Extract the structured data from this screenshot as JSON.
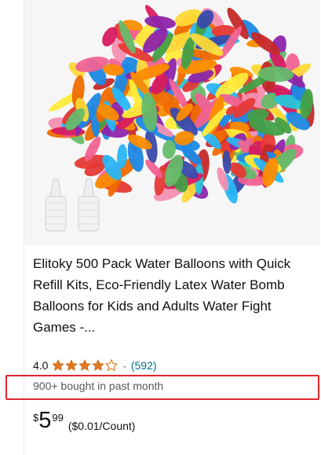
{
  "product": {
    "title": "Elitoky 500 Pack Water Balloons with Quick Refill Kits, Eco-Friendly Latex Water Bomb Balloons for Kids and Adults Water Fight Games -...",
    "rating": {
      "value": "4.0",
      "stars": 4,
      "max_stars": 5,
      "dropdown_icon": "chevron-down-icon",
      "review_count": "(592)"
    },
    "bought_text": "900+ bought in past month",
    "price": {
      "symbol": "$",
      "whole": "5",
      "fraction": "99",
      "unit_price": "($0.01/Count)"
    },
    "image_icon": "water-balloons-image"
  },
  "colors": {
    "title_text": "#0f1111",
    "star": "#de7921",
    "link": "#007185",
    "secondary_text": "#565959",
    "highlight_box": "#e0262d"
  }
}
